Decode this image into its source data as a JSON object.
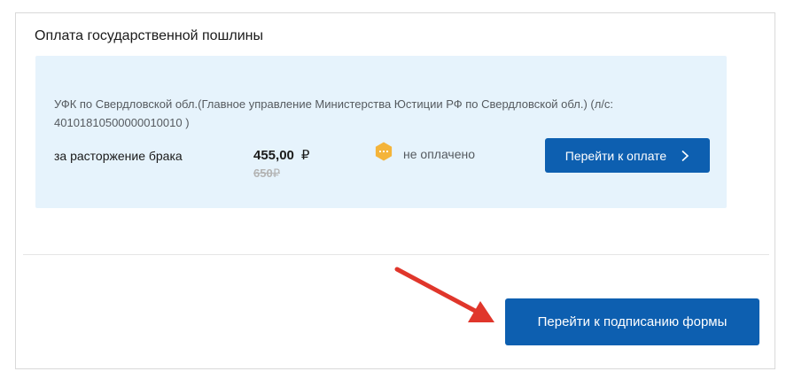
{
  "payment": {
    "title": "Оплата государственной пошлины",
    "recipient": "УФК по Свердловской обл.(Главное управление Министерства Юстиции РФ по Свердловской обл.) (л/с: 40101810500000010010 )",
    "purpose": "за расторжение брака",
    "amount": "455,00",
    "currency": "₽",
    "old_amount": "650",
    "status_icon": "pending-dots-icon",
    "status": "не оплачено",
    "pay_button_label": "Перейти к оплате"
  },
  "actions": {
    "sign_button_label": "Перейти к подписанию формы"
  },
  "annotation": {
    "arrow": "red-pointer-arrow-icon"
  },
  "colors": {
    "primary_button": "#0d5fb0",
    "payment_box_bg": "#e6f3fc",
    "status_icon": "#f4b43a",
    "arrow": "#e0362b"
  }
}
